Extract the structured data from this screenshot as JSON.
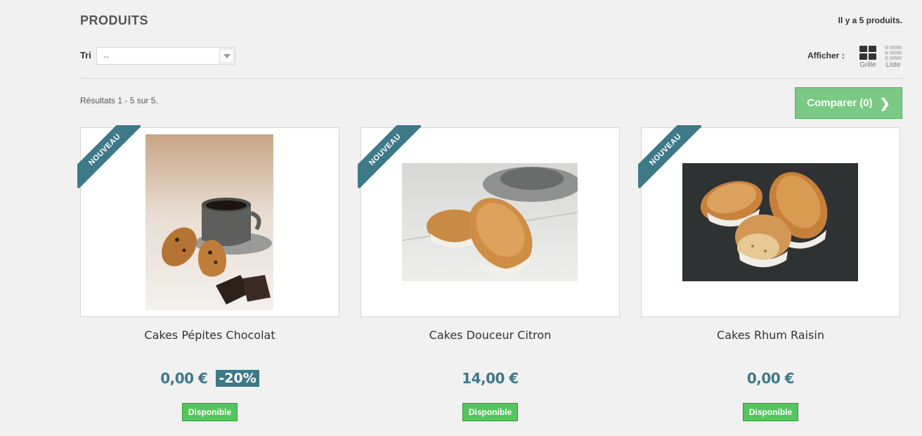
{
  "header": {
    "title": "PRODUITS",
    "product_count": "Il y a 5 produits."
  },
  "sort": {
    "label": "Tri",
    "selected": "--"
  },
  "view": {
    "label": "Afficher :",
    "grid_label": "Grille",
    "list_label": "Liste"
  },
  "results_text": "Résultats 1 - 5 sur 5.",
  "compare": {
    "label": "Comparer (0)"
  },
  "products": [
    {
      "badge": "NOUVEAU",
      "name": "Cakes Pépites Chocolat",
      "price": "0,00 €",
      "discount": "-20%",
      "availability": "Disponible"
    },
    {
      "badge": "NOUVEAU",
      "name": "Cakes Douceur Citron",
      "price": "14,00 €",
      "availability": "Disponible"
    },
    {
      "badge": "NOUVEAU",
      "name": "Cakes Rhum Raisin",
      "price": "0,00 €",
      "availability": "Disponible"
    }
  ],
  "colors": {
    "accent": "#3e7988",
    "compare_button": "#7ac985",
    "availability": "#55c65e"
  }
}
